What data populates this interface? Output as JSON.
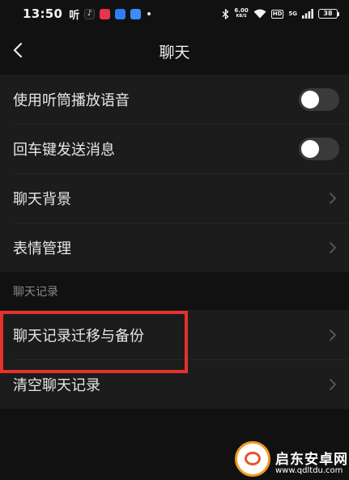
{
  "status_bar": {
    "time": "13:50",
    "ting_label": "听",
    "net_speed_value": "6.00",
    "net_speed_unit": "KB/S",
    "hd_label": "HD",
    "signal_label": "5G",
    "battery": "38",
    "app_colors": [
      "#1b1b1b",
      "#e8344a",
      "#2f7cf6",
      "#3d8bff"
    ]
  },
  "nav": {
    "title": "聊天",
    "back_icon": "chevron-left-icon"
  },
  "settings_group_1": [
    {
      "label": "使用听筒播放语音",
      "control": "toggle",
      "on": false
    },
    {
      "label": "回车键发送消息",
      "control": "toggle",
      "on": false
    },
    {
      "label": "聊天背景",
      "control": "chevron"
    },
    {
      "label": "表情管理",
      "control": "chevron"
    }
  ],
  "section_header": "聊天记录",
  "settings_group_2": [
    {
      "label": "聊天记录迁移与备份",
      "control": "chevron",
      "highlighted": true
    },
    {
      "label": "清空聊天记录",
      "control": "chevron"
    }
  ],
  "colors": {
    "background": "#111111",
    "row_background": "#1c1c1c",
    "highlight": "#e5322d",
    "text": "#e6e6e6",
    "muted": "#8a8a8a"
  },
  "watermark": {
    "name": "启东安卓网",
    "url": "www.qdltdu.com"
  }
}
